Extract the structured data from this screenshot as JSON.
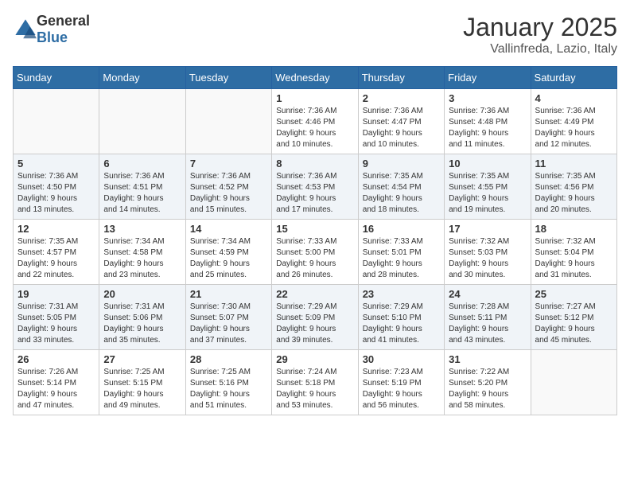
{
  "logo": {
    "general": "General",
    "blue": "Blue"
  },
  "title": {
    "month": "January 2025",
    "location": "Vallinfreda, Lazio, Italy"
  },
  "headers": [
    "Sunday",
    "Monday",
    "Tuesday",
    "Wednesday",
    "Thursday",
    "Friday",
    "Saturday"
  ],
  "weeks": [
    [
      {
        "day": "",
        "info": ""
      },
      {
        "day": "",
        "info": ""
      },
      {
        "day": "",
        "info": ""
      },
      {
        "day": "1",
        "info": "Sunrise: 7:36 AM\nSunset: 4:46 PM\nDaylight: 9 hours\nand 10 minutes."
      },
      {
        "day": "2",
        "info": "Sunrise: 7:36 AM\nSunset: 4:47 PM\nDaylight: 9 hours\nand 10 minutes."
      },
      {
        "day": "3",
        "info": "Sunrise: 7:36 AM\nSunset: 4:48 PM\nDaylight: 9 hours\nand 11 minutes."
      },
      {
        "day": "4",
        "info": "Sunrise: 7:36 AM\nSunset: 4:49 PM\nDaylight: 9 hours\nand 12 minutes."
      }
    ],
    [
      {
        "day": "5",
        "info": "Sunrise: 7:36 AM\nSunset: 4:50 PM\nDaylight: 9 hours\nand 13 minutes."
      },
      {
        "day": "6",
        "info": "Sunrise: 7:36 AM\nSunset: 4:51 PM\nDaylight: 9 hours\nand 14 minutes."
      },
      {
        "day": "7",
        "info": "Sunrise: 7:36 AM\nSunset: 4:52 PM\nDaylight: 9 hours\nand 15 minutes."
      },
      {
        "day": "8",
        "info": "Sunrise: 7:36 AM\nSunset: 4:53 PM\nDaylight: 9 hours\nand 17 minutes."
      },
      {
        "day": "9",
        "info": "Sunrise: 7:35 AM\nSunset: 4:54 PM\nDaylight: 9 hours\nand 18 minutes."
      },
      {
        "day": "10",
        "info": "Sunrise: 7:35 AM\nSunset: 4:55 PM\nDaylight: 9 hours\nand 19 minutes."
      },
      {
        "day": "11",
        "info": "Sunrise: 7:35 AM\nSunset: 4:56 PM\nDaylight: 9 hours\nand 20 minutes."
      }
    ],
    [
      {
        "day": "12",
        "info": "Sunrise: 7:35 AM\nSunset: 4:57 PM\nDaylight: 9 hours\nand 22 minutes."
      },
      {
        "day": "13",
        "info": "Sunrise: 7:34 AM\nSunset: 4:58 PM\nDaylight: 9 hours\nand 23 minutes."
      },
      {
        "day": "14",
        "info": "Sunrise: 7:34 AM\nSunset: 4:59 PM\nDaylight: 9 hours\nand 25 minutes."
      },
      {
        "day": "15",
        "info": "Sunrise: 7:33 AM\nSunset: 5:00 PM\nDaylight: 9 hours\nand 26 minutes."
      },
      {
        "day": "16",
        "info": "Sunrise: 7:33 AM\nSunset: 5:01 PM\nDaylight: 9 hours\nand 28 minutes."
      },
      {
        "day": "17",
        "info": "Sunrise: 7:32 AM\nSunset: 5:03 PM\nDaylight: 9 hours\nand 30 minutes."
      },
      {
        "day": "18",
        "info": "Sunrise: 7:32 AM\nSunset: 5:04 PM\nDaylight: 9 hours\nand 31 minutes."
      }
    ],
    [
      {
        "day": "19",
        "info": "Sunrise: 7:31 AM\nSunset: 5:05 PM\nDaylight: 9 hours\nand 33 minutes."
      },
      {
        "day": "20",
        "info": "Sunrise: 7:31 AM\nSunset: 5:06 PM\nDaylight: 9 hours\nand 35 minutes."
      },
      {
        "day": "21",
        "info": "Sunrise: 7:30 AM\nSunset: 5:07 PM\nDaylight: 9 hours\nand 37 minutes."
      },
      {
        "day": "22",
        "info": "Sunrise: 7:29 AM\nSunset: 5:09 PM\nDaylight: 9 hours\nand 39 minutes."
      },
      {
        "day": "23",
        "info": "Sunrise: 7:29 AM\nSunset: 5:10 PM\nDaylight: 9 hours\nand 41 minutes."
      },
      {
        "day": "24",
        "info": "Sunrise: 7:28 AM\nSunset: 5:11 PM\nDaylight: 9 hours\nand 43 minutes."
      },
      {
        "day": "25",
        "info": "Sunrise: 7:27 AM\nSunset: 5:12 PM\nDaylight: 9 hours\nand 45 minutes."
      }
    ],
    [
      {
        "day": "26",
        "info": "Sunrise: 7:26 AM\nSunset: 5:14 PM\nDaylight: 9 hours\nand 47 minutes."
      },
      {
        "day": "27",
        "info": "Sunrise: 7:25 AM\nSunset: 5:15 PM\nDaylight: 9 hours\nand 49 minutes."
      },
      {
        "day": "28",
        "info": "Sunrise: 7:25 AM\nSunset: 5:16 PM\nDaylight: 9 hours\nand 51 minutes."
      },
      {
        "day": "29",
        "info": "Sunrise: 7:24 AM\nSunset: 5:18 PM\nDaylight: 9 hours\nand 53 minutes."
      },
      {
        "day": "30",
        "info": "Sunrise: 7:23 AM\nSunset: 5:19 PM\nDaylight: 9 hours\nand 56 minutes."
      },
      {
        "day": "31",
        "info": "Sunrise: 7:22 AM\nSunset: 5:20 PM\nDaylight: 9 hours\nand 58 minutes."
      },
      {
        "day": "",
        "info": ""
      }
    ]
  ]
}
